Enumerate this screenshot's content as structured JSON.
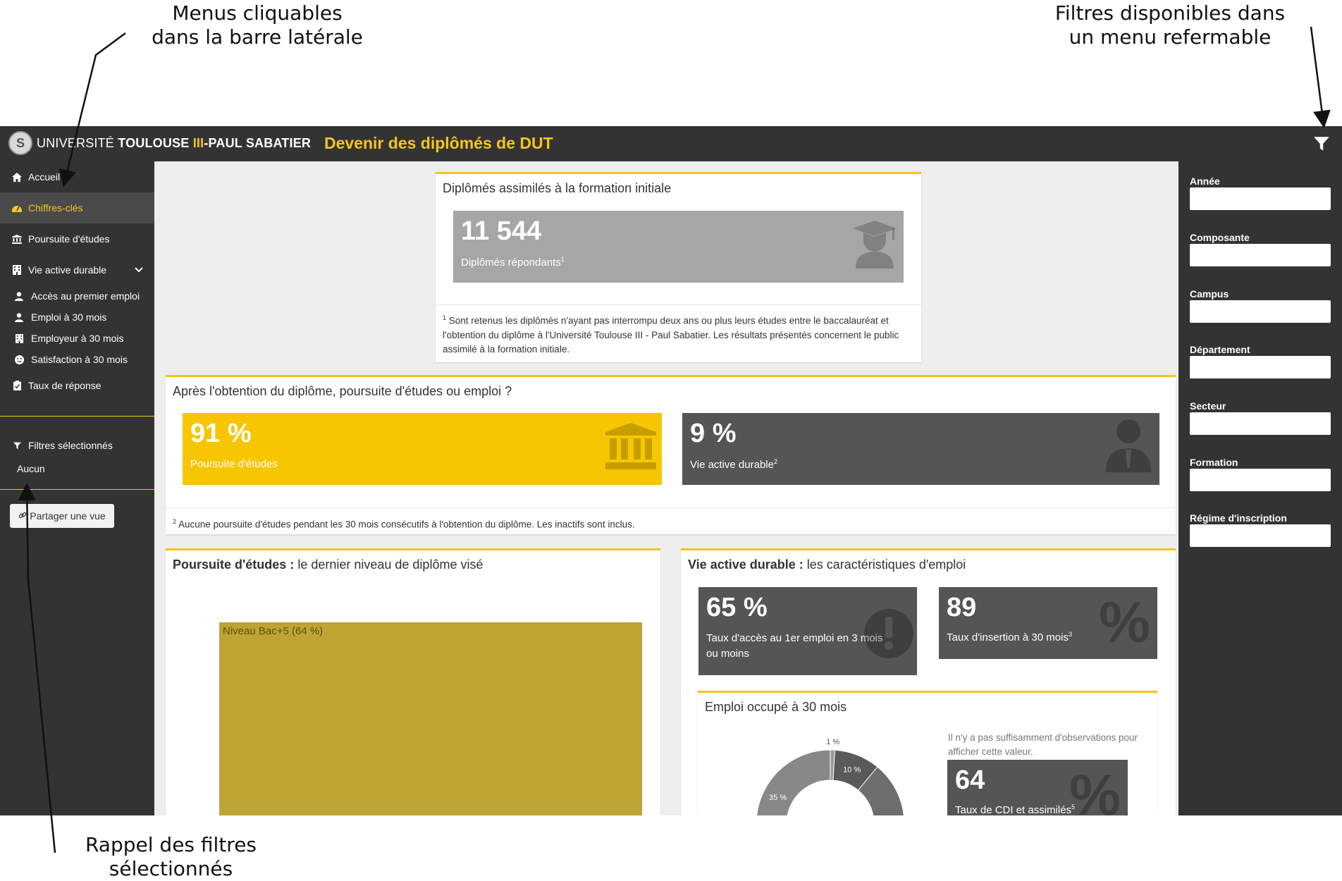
{
  "annotations": {
    "top_left": [
      "Menus cliquables",
      "dans la barre latérale"
    ],
    "top_right": [
      "Filtres disponibles dans",
      "un menu refermable"
    ],
    "bottom_left": [
      "Rappel des filtres",
      "sélectionnés"
    ]
  },
  "header": {
    "logo_parts": {
      "a": "UNIVERSITÉ ",
      "b": "TOULOUSE ",
      "c": "III",
      "d": "-PAUL SABATIER"
    },
    "title": "Devenir des diplômés de DUT",
    "accent": "#f5c518",
    "bar_color": "#333333"
  },
  "sidebar": {
    "items": [
      {
        "label": "Accueil",
        "icon": "home-icon"
      },
      {
        "label": "Chiffres-clés",
        "icon": "dashboard-icon",
        "active": true
      },
      {
        "label": "Poursuite d'études",
        "icon": "institution-icon"
      },
      {
        "label": "Vie active durable",
        "icon": "building-icon"
      }
    ],
    "subitems": [
      {
        "label": "Accès au premier emploi",
        "icon": "user-icon"
      },
      {
        "label": "Emploi à 30 mois",
        "icon": "user-icon"
      },
      {
        "label": "Employeur à 30 mois",
        "icon": "building-icon"
      },
      {
        "label": "Satisfaction à 30 mois",
        "icon": "smile-icon"
      }
    ],
    "response_rate": "Taux de réponse",
    "selected_filters_title": "Filtres sélectionnés",
    "selected_filters_value": "Aucun",
    "share_label": "Partager une vue"
  },
  "filters": [
    {
      "label": "Année"
    },
    {
      "label": "Composante"
    },
    {
      "label": "Campus"
    },
    {
      "label": "Département"
    },
    {
      "label": "Secteur"
    },
    {
      "label": "Formation"
    },
    {
      "label": "Régime d'inscription"
    }
  ],
  "graduates": {
    "title": "Diplômés assimilés à la formation initiale",
    "value": "11 544",
    "label": "Diplômés répondants",
    "footnote_mark": "1",
    "note_mark": "1",
    "note": "Sont retenus les diplômés n'ayant pas interrompu deux ans ou plus leurs études entre le baccalauréat et l'obtention du diplôme à l'Université Toulouse III - Paul Sabatier. Les résultats présentés concernent le public assimilé à la formation initiale."
  },
  "after_diploma": {
    "title": "Après l'obtention du diplôme, poursuite d'études ou emploi ?",
    "studies": {
      "value": "91 %",
      "label": "Poursuite d'études",
      "color": "#f8c600"
    },
    "active": {
      "value": "9 %",
      "label": "Vie active durable",
      "mark": "2",
      "color": "#555555"
    },
    "note_mark": "2",
    "note": "Aucune poursuite d'études pendant les 30 mois consécutifs à l'obtention du diplôme. Les inactifs sont inclus."
  },
  "studies_card": {
    "title_bold": "Poursuite d'études :",
    "title_rest": " le dernier niveau de diplôme visé",
    "tile_label": "Niveau Bac+5 (64 %)",
    "tile_color": "#bfa434"
  },
  "employment_card": {
    "title_bold": "Vie active durable :",
    "title_rest": " les caractéristiques d'emploi",
    "access": {
      "value": "65 %",
      "label": "Taux d'accès au 1er emploi en 3 mois ou moins"
    },
    "insertion": {
      "value": "89",
      "label": "Taux d'insertion à 30 mois",
      "mark": "3"
    },
    "job_card": {
      "title": "Emploi occupé à 30 mois",
      "insufficient_note": "Il n'y a pas suffisamment d'observations pour afficher cette valeur.",
      "cdi": {
        "value": "64",
        "label": "Taux de CDI et assimilés",
        "mark": "5"
      }
    }
  },
  "chart_data": {
    "type": "pie",
    "title": "",
    "slices": [
      {
        "label": "1 %",
        "value": 1,
        "color": "#9a9a9a"
      },
      {
        "label": "10 %",
        "value": 10,
        "color": "#5a5a5a"
      },
      {
        "label": "",
        "value": 54,
        "color": "#6e6e6e"
      },
      {
        "label": "35 %",
        "value": 35,
        "color": "#888888"
      }
    ]
  }
}
